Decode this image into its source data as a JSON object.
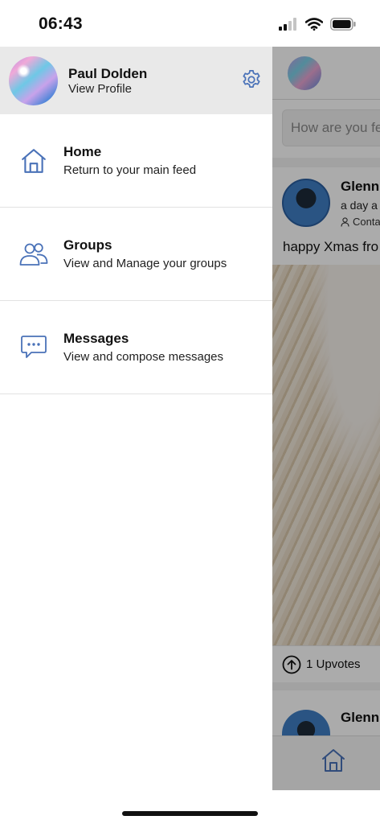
{
  "status_bar": {
    "time": "06:43"
  },
  "drawer": {
    "profile": {
      "name": "Paul Dolden",
      "subtitle": "View Profile"
    },
    "items": [
      {
        "title": "Home",
        "subtitle": "Return to your main feed",
        "icon": "home-icon"
      },
      {
        "title": "Groups",
        "subtitle": "View and Manage your groups",
        "icon": "groups-icon"
      },
      {
        "title": "Messages",
        "subtitle": "View and compose messages",
        "icon": "messages-icon"
      }
    ]
  },
  "feed": {
    "composer_placeholder": "How are you feeling?",
    "post": {
      "author": "Glenn",
      "time": "a day a",
      "contact": "Conta",
      "text": "happy Xmas fro",
      "upvotes": "1 Upvotes"
    },
    "post2": {
      "author": "Glenn"
    }
  },
  "colors": {
    "accent": "#4a72b8",
    "drawer_header": "#e9e9e9"
  }
}
